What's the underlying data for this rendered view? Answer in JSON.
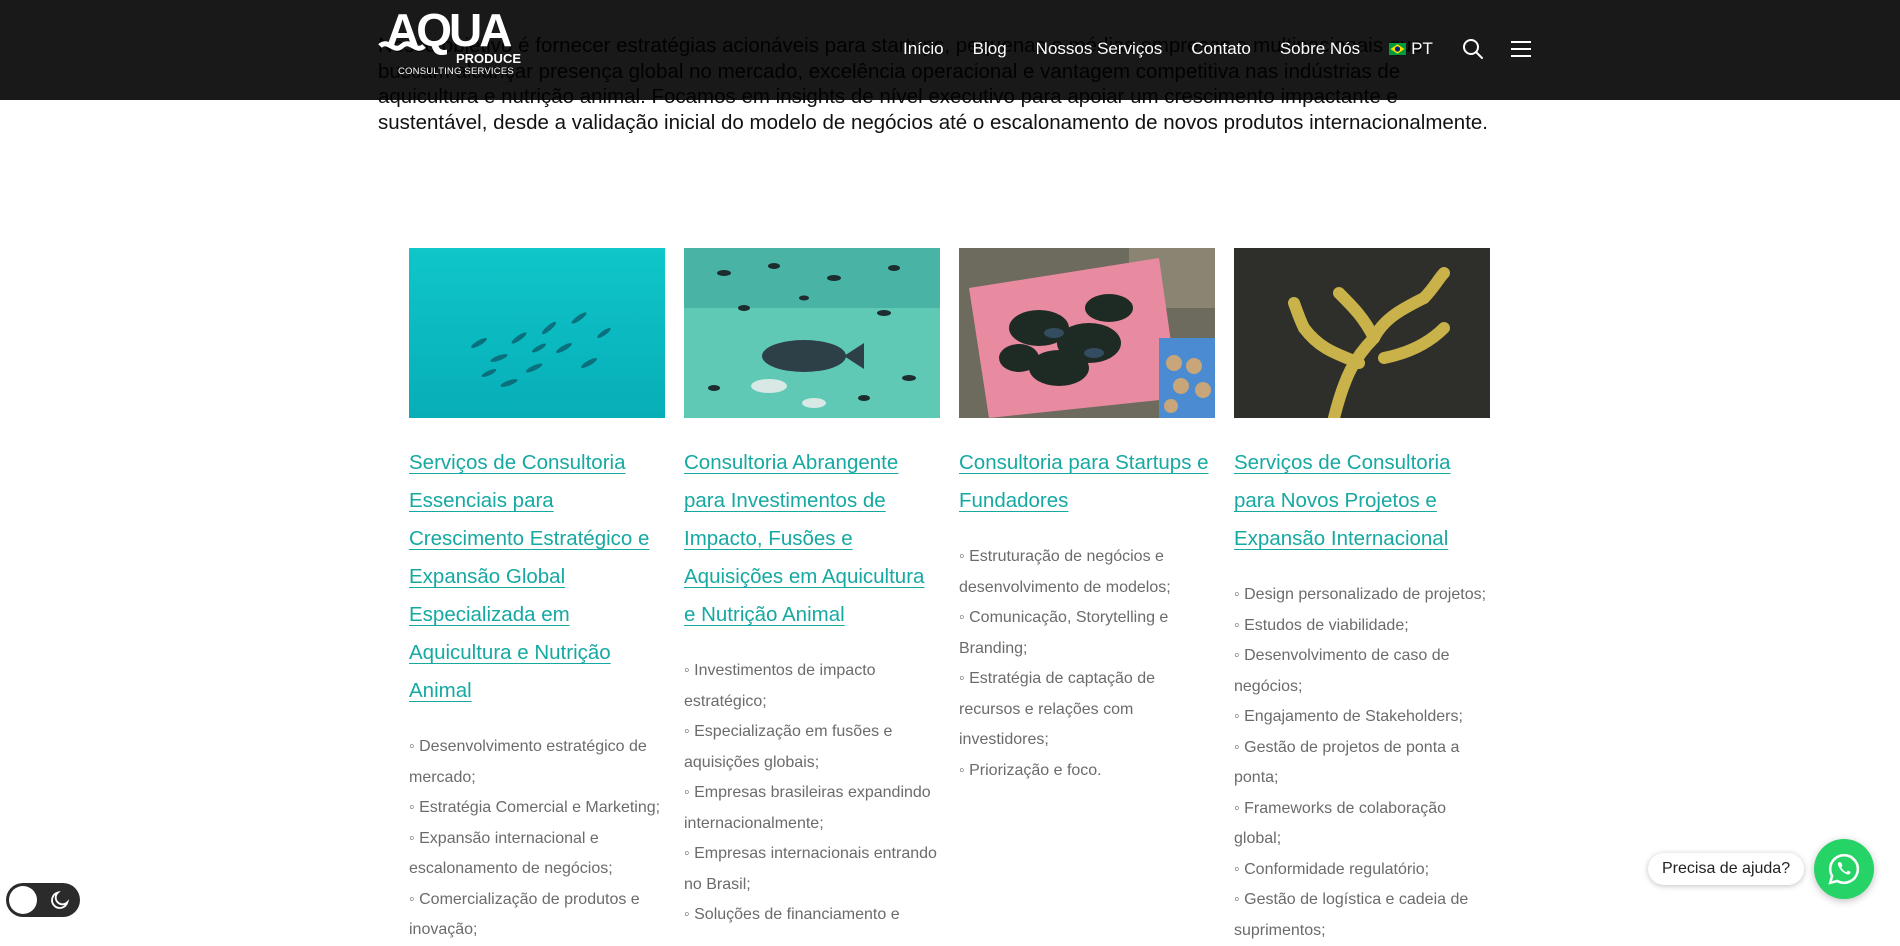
{
  "intro": {
    "text": "Nosso objetivo é fornecer estratégias acionáveis para startups, pequenas e médias empresas e multinacionais que buscam alcançar presença global no mercado, excelência operacional e vantagem competitiva nas indústrias de aquicultura e nutrição animal. Focamos em insights de nível executivo para apoiar um crescimento impactante e sustentável, desde a validação inicial do modelo de negócios até o escalonamento de novos produtos internacionalmente."
  },
  "header": {
    "logo_main": "AQUA",
    "logo_produce": "PRODUCE",
    "logo_sub": "CONSULTING SERVICES",
    "nav": [
      "Início",
      "Blog",
      "Nossos Serviços",
      "Contato",
      "Sobre Nós"
    ],
    "lang": "PT",
    "icons": [
      "brazil-flag-icon",
      "search-icon",
      "menu-icon"
    ]
  },
  "columns": [
    {
      "image": "teal-water-fish-school",
      "title": "Serviços de Consultoria Essenciais para Crescimento Estratégico e Expansão Global Especializada em Aquicultura e Nutrição Animal",
      "items": [
        "◦ Desenvolvimento estratégico de mercado;",
        "◦ Estratégia Comercial e Marketing;",
        "◦ Expansão internacional e escalonamento de negócios;",
        "◦ Comercialização de produtos e inovação;"
      ]
    },
    {
      "image": "aquarium-fish",
      "title": "Consultoria Abrangente para Investimentos de Impacto, Fusões e Aquisições em Aquicultura e Nutrição Animal",
      "items": [
        "◦ Investimentos de impacto estratégico;",
        "◦ Especialização em fusões e aquisições globais;",
        "◦ Empresas brasileiras expandindo internacionalmente;",
        "◦ Empresas internacionais entrando no Brasil;",
        "◦ Soluções de financiamento e"
      ]
    },
    {
      "image": "seafood-basket-market",
      "title": "Consultoria para Startups e Fundadores",
      "items": [
        "◦ Estruturação de negócios e desenvolvimento de modelos;",
        "◦ Comunicação, Storytelling e Branding;",
        "◦ Estratégia de captação de recursos e relações com investidores;",
        "◦ Priorização e foco."
      ]
    },
    {
      "image": "yellow-coral",
      "title": "Serviços de Consultoria para Novos Projetos e Expansão Internacional",
      "items": [
        "◦ Design personalizado de projetos;",
        "◦ Estudos de viabilidade;",
        "◦ Desenvolvimento de caso de negócios;",
        "◦ Engajamento de Stakeholders;",
        "◦ Gestão de projetos de ponta a ponta;",
        "◦ Frameworks de colaboração global;",
        "◦ Conformidade regulatório;",
        "◦ Gestão de logística e cadeia de suprimentos;"
      ]
    }
  ],
  "widgets": {
    "help_text": "Precisa de ajuda?",
    "whatsapp_icon": "whatsapp-icon",
    "dark_mode_icon": "moon-icon"
  },
  "colors": {
    "accent": "#16a9a2",
    "header_bg": "#111111",
    "whatsapp": "#25d366",
    "list_text": "#6b6b6b"
  }
}
